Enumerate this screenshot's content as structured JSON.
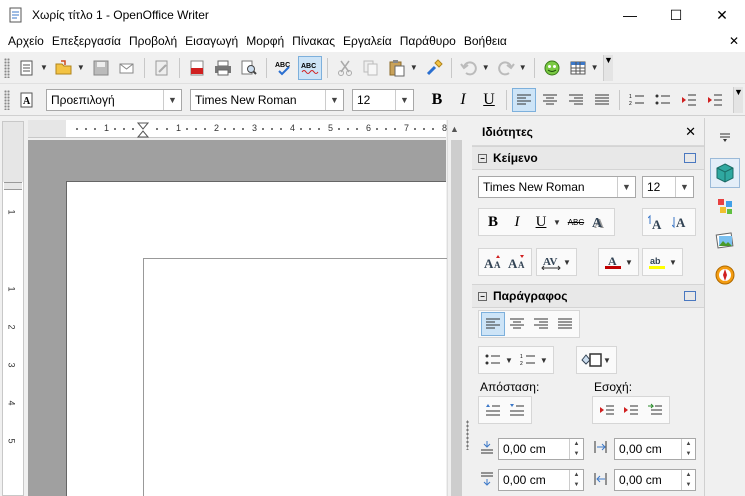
{
  "window": {
    "title": "Χωρίς τίτλο 1 - OpenOffice Writer",
    "minimize": "—",
    "maximize": "☐",
    "close": "✕"
  },
  "menu": {
    "items": [
      "Αρχείο",
      "Επεξεργασία",
      "Προβολή",
      "Εισαγωγή",
      "Μορφή",
      "Πίνακας",
      "Εργαλεία",
      "Παράθυρο",
      "Βοήθεια"
    ],
    "close": "✕"
  },
  "formatting": {
    "paragraph_style": "Προεπιλογή",
    "font_name": "Times New Roman",
    "font_size": "12",
    "bold": "B",
    "italic": "I",
    "underline": "U"
  },
  "ruler": {
    "h_numbers": [
      "1",
      "1",
      "2",
      "3",
      "4",
      "5",
      "6",
      "7",
      "8"
    ],
    "v_numbers": [
      "1",
      "1",
      "2",
      "3",
      "4",
      "5"
    ]
  },
  "sidebar": {
    "title": "Ιδιότητες",
    "close": "✕",
    "text_section": {
      "title": "Κείμενο",
      "font_name": "Times New Roman",
      "font_size": "12",
      "bold": "B",
      "italic": "I",
      "underline": "U",
      "strike": "ABC"
    },
    "paragraph_section": {
      "title": "Παράγραφος",
      "spacing_label": "Απόσταση:",
      "indent_label": "Εσοχή:",
      "spacing_above": "0,00 cm",
      "spacing_below": "0,00 cm",
      "indent_before": "0,00 cm",
      "indent_after": "0,00 cm"
    }
  },
  "colors": {
    "accent": "#3c78c8",
    "active_bg": "#cde4f7",
    "font_color": "#c00000",
    "highlight": "#ffff00"
  }
}
